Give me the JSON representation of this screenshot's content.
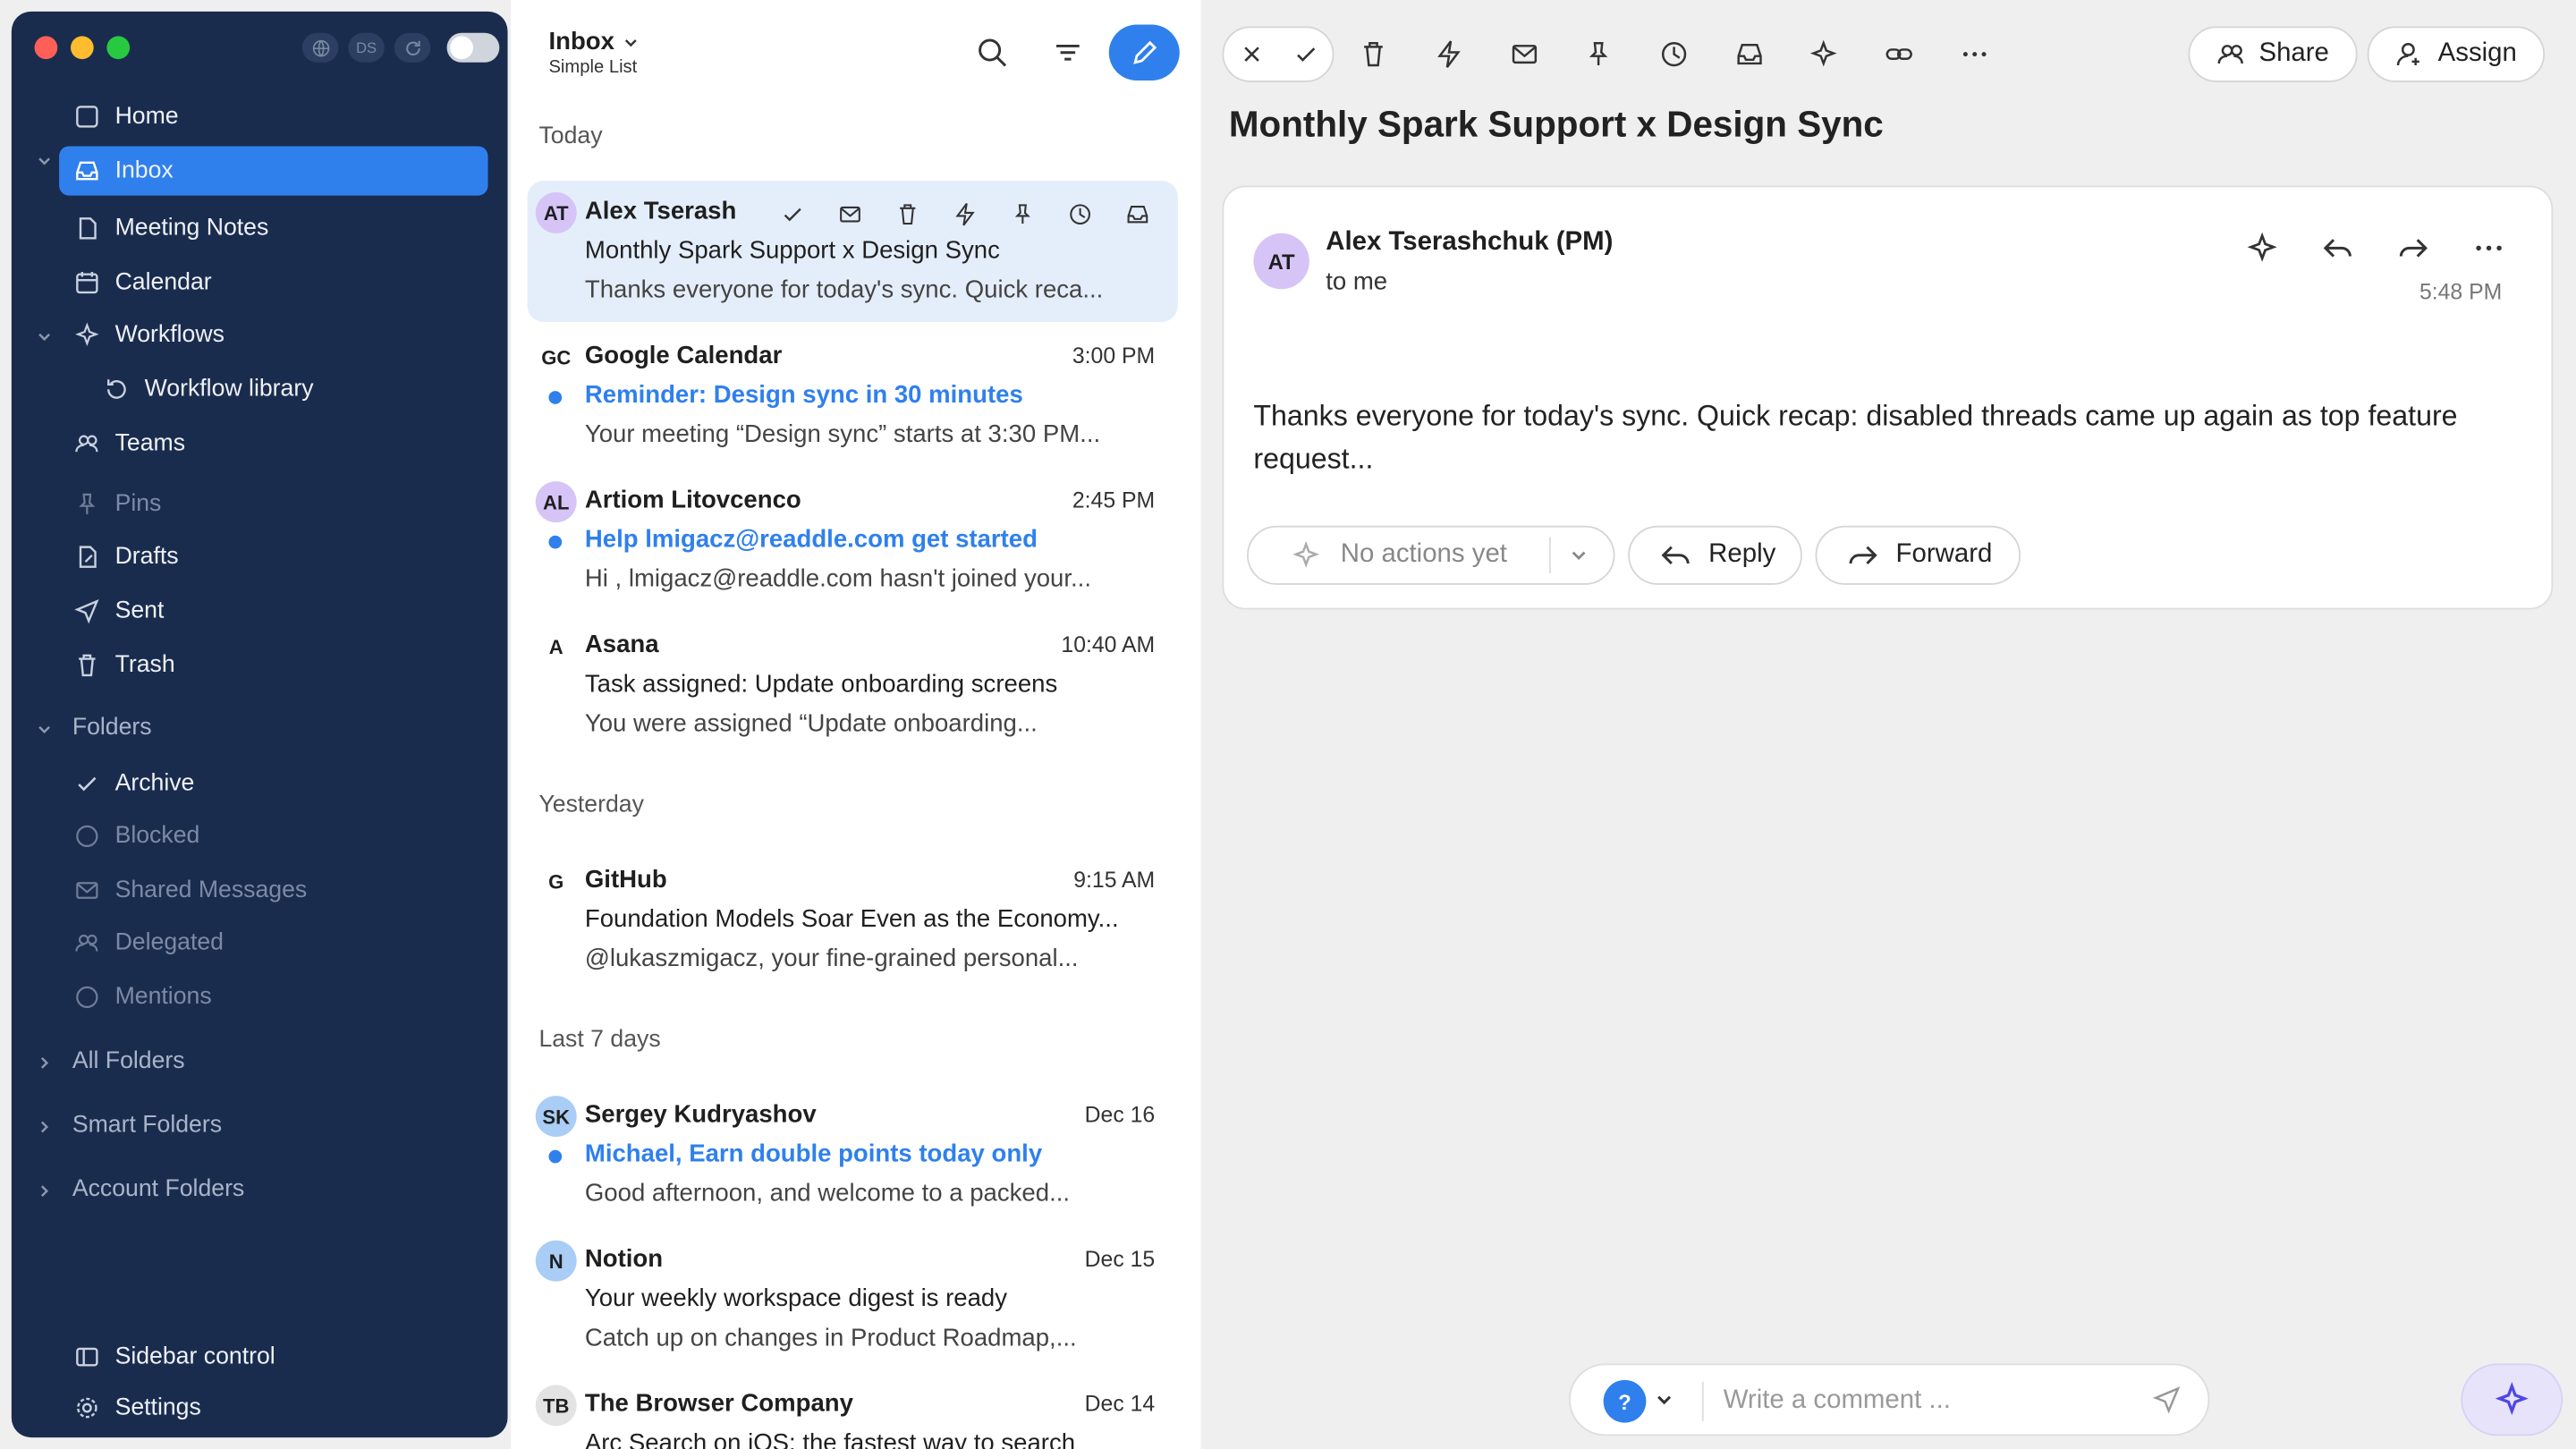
{
  "sidebar": {
    "badge": "DS",
    "items": [
      {
        "label": "Home"
      },
      {
        "label": "Inbox"
      },
      {
        "label": "Meeting Notes"
      },
      {
        "label": "Calendar"
      },
      {
        "label": "Workflows"
      },
      {
        "label": "Workflow library"
      },
      {
        "label": "Teams"
      },
      {
        "label": "Pins"
      },
      {
        "label": "Drafts"
      },
      {
        "label": "Sent"
      },
      {
        "label": "Trash"
      }
    ],
    "folders_label": "Folders",
    "folders": [
      {
        "label": "Archive"
      },
      {
        "label": "Blocked"
      },
      {
        "label": "Shared Messages"
      },
      {
        "label": "Delegated"
      },
      {
        "label": "Mentions"
      }
    ],
    "all_folders": "All Folders",
    "smart_folders": "Smart Folders",
    "account_folders": "Account Folders",
    "sidebar_control": "Sidebar control",
    "settings": "Settings"
  },
  "list": {
    "title": "Inbox",
    "subtitle": "Simple List",
    "sections": [
      "Today",
      "Yesterday",
      "Last 7 days"
    ],
    "messages": [
      {
        "initials": "AT",
        "sender": "Alex Tserash",
        "time": "",
        "subject": "Monthly Spark Support x Design Sync",
        "preview": "Thanks everyone for today's sync. Quick reca..."
      },
      {
        "initials": "GC",
        "sender": "Google Calendar",
        "time": "3:00 PM",
        "subject": "Reminder: Design sync in 30 minutes",
        "preview": "Your meeting “Design sync” starts at 3:30 PM..."
      },
      {
        "initials": "AL",
        "sender": "Artiom Litovcenco",
        "time": "2:45 PM",
        "subject": "Help lmigacz@readdle.com get started",
        "preview": "Hi , lmigacz@readdle.com hasn't joined your..."
      },
      {
        "initials": "A",
        "sender": "Asana",
        "time": "10:40 AM",
        "subject": "Task assigned: Update onboarding screens",
        "preview": "You were assigned “Update onboarding..."
      },
      {
        "initials": "G",
        "sender": "GitHub",
        "time": "9:15 AM",
        "subject": "Foundation Models Soar Even as the Economy...",
        "preview": "@lukaszmigacz, your fine-grained personal..."
      },
      {
        "initials": "SK",
        "sender": "Sergey Kudryashov",
        "time": "Dec 16",
        "subject": "Michael, Earn double points today only",
        "preview": "Good afternoon, and welcome to a packed..."
      },
      {
        "initials": "N",
        "sender": "Notion",
        "time": "Dec 15",
        "subject": "Your weekly workspace digest is ready",
        "preview": "Catch up on changes in Product Roadmap,..."
      },
      {
        "initials": "TB",
        "sender": "The Browser Company",
        "time": "Dec 14",
        "subject": "",
        "preview": "Arc Search on iOS: the fastest way to search"
      }
    ]
  },
  "reader": {
    "share": "Share",
    "assign": "Assign",
    "title": "Monthly Spark Support x Design Sync",
    "from": "Alex Tserashchuk (PM)",
    "to": "to me",
    "initials": "AT",
    "time": "5:48 PM",
    "body": "Thanks everyone for today's sync. Quick recap: disabled threads came up again as top feature request...",
    "no_actions": "No actions yet",
    "reply": "Reply",
    "forward": "Forward",
    "comment_placeholder": "Write a comment ...",
    "help": "?"
  },
  "colors": {
    "accent": "#2f80ed",
    "sidebar": "#1a2c4e",
    "selected": "#e4eefb"
  }
}
